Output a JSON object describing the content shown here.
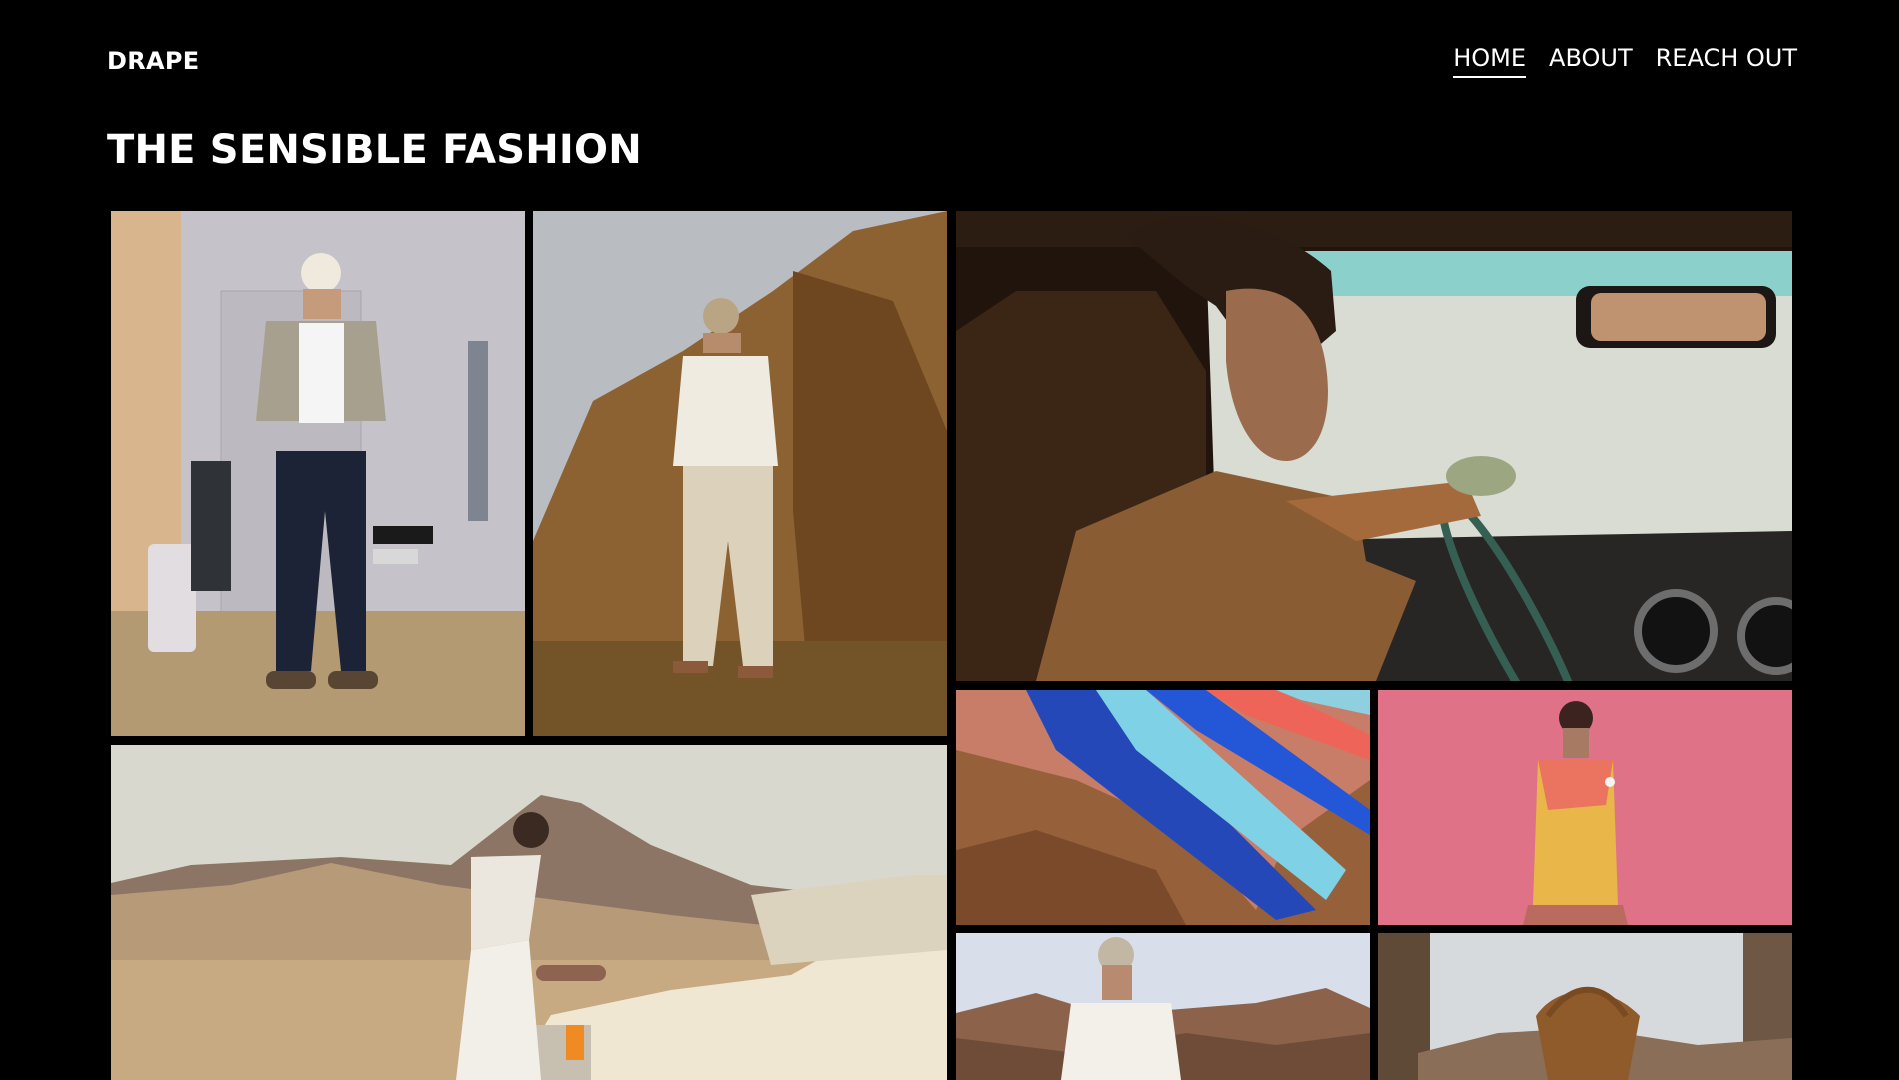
{
  "header": {
    "brand": "DRAPE",
    "nav": [
      {
        "label": "HOME",
        "active": true
      },
      {
        "label": "ABOUT",
        "active": false
      },
      {
        "label": "REACH OUT",
        "active": false
      }
    ]
  },
  "main": {
    "title": "THE SENSIBLE FASHION"
  },
  "colors": {
    "background": "#000000",
    "text": "#ffffff"
  }
}
